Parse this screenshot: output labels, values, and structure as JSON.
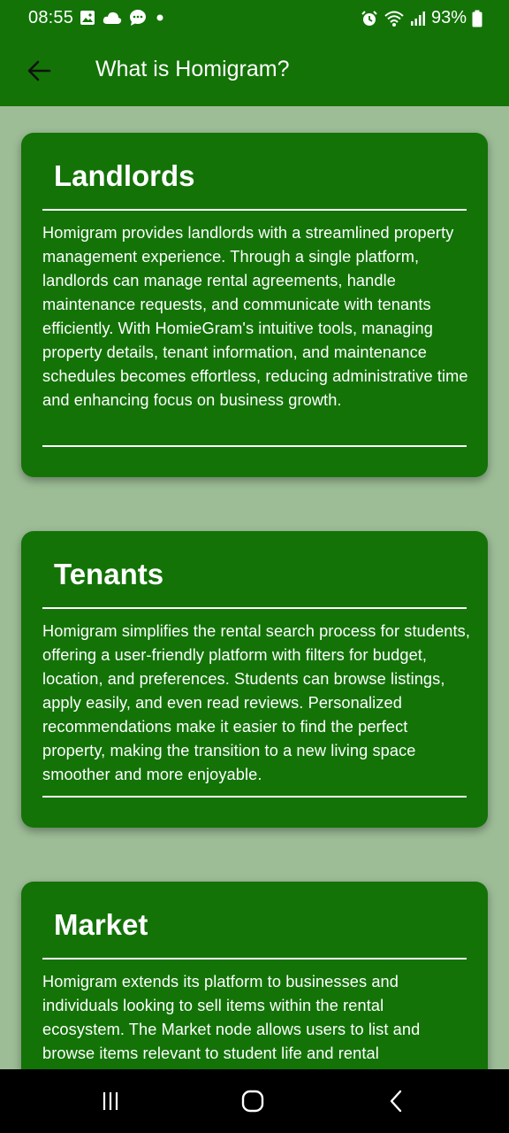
{
  "status_bar": {
    "time": "08:55",
    "battery": "93%"
  },
  "app_bar": {
    "title": "What is Homigram?"
  },
  "cards": [
    {
      "title": "Landlords",
      "body": "Homigram provides landlords with a streamlined property management experience. Through a single platform, landlords can manage rental agreements, handle maintenance requests, and communicate with tenants efficiently. With HomieGram's intuitive tools, managing property details, tenant information, and maintenance schedules becomes effortless, reducing administrative time and enhancing focus on business growth."
    },
    {
      "title": "Tenants",
      "body": "Homigram simplifies the rental search process for students, offering a user-friendly platform with filters for budget, location, and preferences. Students can browse listings, apply easily, and even read reviews. Personalized recommendations make it easier to find the perfect property, making the transition to a new living space smoother and more enjoyable."
    },
    {
      "title": "Market",
      "body": "Homigram extends its platform to businesses and individuals looking to sell items within the rental ecosystem. The Market node allows users to list and browse items relevant to student life and rental"
    }
  ],
  "colors": {
    "primary": "#137307",
    "background": "#9dbd97"
  }
}
